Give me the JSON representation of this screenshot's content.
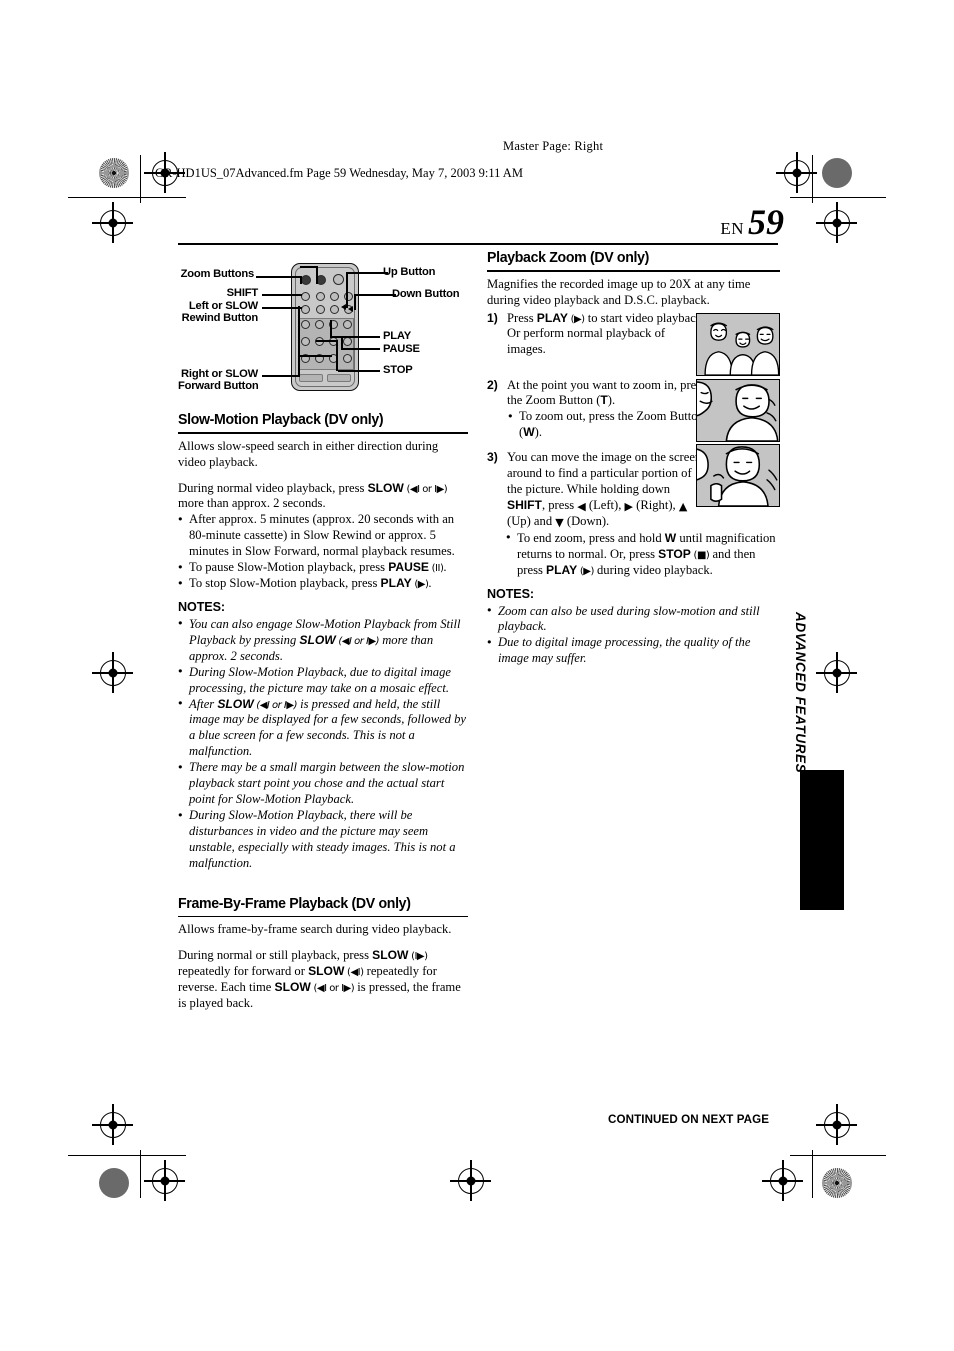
{
  "header": {
    "master_page": "Master Page: Right",
    "file_line": "GR-HD1US_07Advanced.fm  Page 59  Wednesday, May 7, 2003  9:11 AM"
  },
  "page_number": {
    "language": "EN",
    "number": "59"
  },
  "side_tab": {
    "label": "ADVANCED FEATURES"
  },
  "footer": {
    "continued": "CONTINUED ON NEXT PAGE"
  },
  "remote_diagram": {
    "callouts_left": [
      "Zoom Buttons",
      "SHIFT",
      "Left or SLOW\nRewind Button",
      "Right or SLOW\nForward Button"
    ],
    "zoom_buttons_label": "Zoom Buttons",
    "shift_label": "SHIFT",
    "left_slow_label_line1": "Left or SLOW",
    "left_slow_label_line2": "Rewind Button",
    "right_slow_label_line1": "Right or SLOW",
    "right_slow_label_line2": "Forward Button",
    "up_button_label": "Up Button",
    "down_button_label": "Down Button",
    "play_label": "PLAY",
    "pause_label": "PAUSE",
    "stop_label": "STOP"
  },
  "left_column": {
    "section1": {
      "title": "Slow-Motion Playback (DV only)",
      "intro": "Allows slow-speed search in either direction during video playback.",
      "para_prefix": "During normal video playback, press ",
      "para_bold": "SLOW",
      "para_glyph": " (◀I or I▶)",
      "para_suffix": " more than approx. 2 seconds.",
      "bullets": [
        {
          "text": "After approx. 5 minutes (approx. 20 seconds with an 80-minute cassette) in Slow Rewind or approx. 5 minutes in Slow Forward, normal playback resumes."
        },
        {
          "prefix": "To pause Slow-Motion playback, press ",
          "bold": "PAUSE",
          "glyph": " (II)",
          "suffix": "."
        },
        {
          "prefix": "To stop Slow-Motion playback, press ",
          "bold": "PLAY",
          "glyph": " (▶)",
          "suffix": "."
        }
      ],
      "notes_heading": "NOTES:",
      "notes": [
        {
          "prefix": "You can also engage Slow-Motion Playback from Still Playback by pressing ",
          "bold": "SLOW",
          "glyph": " (◀I or I▶)",
          "suffix": " more than approx. 2 seconds."
        },
        {
          "text": "During Slow-Motion Playback, due to digital image processing, the picture may take on a mosaic effect."
        },
        {
          "prefix": "After ",
          "bold": "SLOW",
          "glyph": " (◀I or I▶)",
          "suffix": " is pressed and held, the still image may be displayed for a few seconds, followed by a blue screen for a few seconds. This is not a malfunction."
        },
        {
          "text": "There may be a small margin between the slow-motion playback start point you chose and the actual start point for Slow-Motion Playback."
        },
        {
          "text": "During Slow-Motion Playback, there will be disturbances in video and the picture may seem unstable, especially with steady images. This is not a malfunction."
        }
      ]
    },
    "section2": {
      "title": "Frame-By-Frame Playback (DV only)",
      "intro": "Allows frame-by-frame search during video playback.",
      "para_p1": "During normal or still playback, press ",
      "para_b1": "SLOW",
      "para_g1": " (I▶)",
      "para_p2": " repeatedly for forward or ",
      "para_b2": "SLOW",
      "para_g2": " (◀I)",
      "para_p3": " repeatedly for reverse. Each time ",
      "para_b3": "SLOW",
      "para_g3": " (◀I or I▶)",
      "para_p4": " is pressed, the frame is played back."
    }
  },
  "right_column": {
    "section1": {
      "title": "Playback Zoom (DV only)",
      "intro": "Magnifies the recorded image up to 20X at any time during video playback and D.S.C. playback.",
      "steps": [
        {
          "prefix": "Press ",
          "bold": "PLAY",
          "glyph": " (▶)",
          "suffix": " to start video playback. Or perform normal playback of images."
        },
        {
          "text_a": "At the point you want to zoom in, press the Zoom Button (",
          "bold_a": "T",
          "text_b": ").",
          "sub_prefix": "To zoom out, press the Zoom Button (",
          "sub_bold": "W",
          "sub_suffix": ")."
        },
        {
          "text_a": "You can move the image on the screen around to find a particular portion of the picture. While holding down ",
          "bold_a": "SHIFT",
          "text_b": ", press ",
          "glyph_left": "◀",
          "label_left": " (Left), ",
          "glyph_right": "▶",
          "label_right": " (Right), ",
          "glyph_up": "▲",
          "label_up": " (Up) and ",
          "glyph_down": "▼",
          "label_down": " (Down).",
          "sub_t1": "To end zoom, press and hold ",
          "sub_b1": "W",
          "sub_t2": " until magnification returns to normal. Or, press ",
          "sub_b2": "STOP",
          "sub_g2": " (■)",
          "sub_t3": " and then press ",
          "sub_b3": "PLAY",
          "sub_g3": " (▶)",
          "sub_t4": " during video playback."
        }
      ],
      "notes_heading": "NOTES:",
      "notes": [
        {
          "text": "Zoom can also be used during slow-motion and still playback."
        },
        {
          "text": "Due to digital image processing, the quality of the image may suffer."
        }
      ]
    },
    "illustrations": [
      {
        "name": "illustration-three-people"
      },
      {
        "name": "illustration-zoomed-face"
      },
      {
        "name": "illustration-closeup-face"
      }
    ]
  },
  "colors": {
    "ink": "#000000",
    "paper": "#ffffff",
    "remote_body": "#c9c9c9",
    "illustration_bg": "#c4c4c4"
  }
}
